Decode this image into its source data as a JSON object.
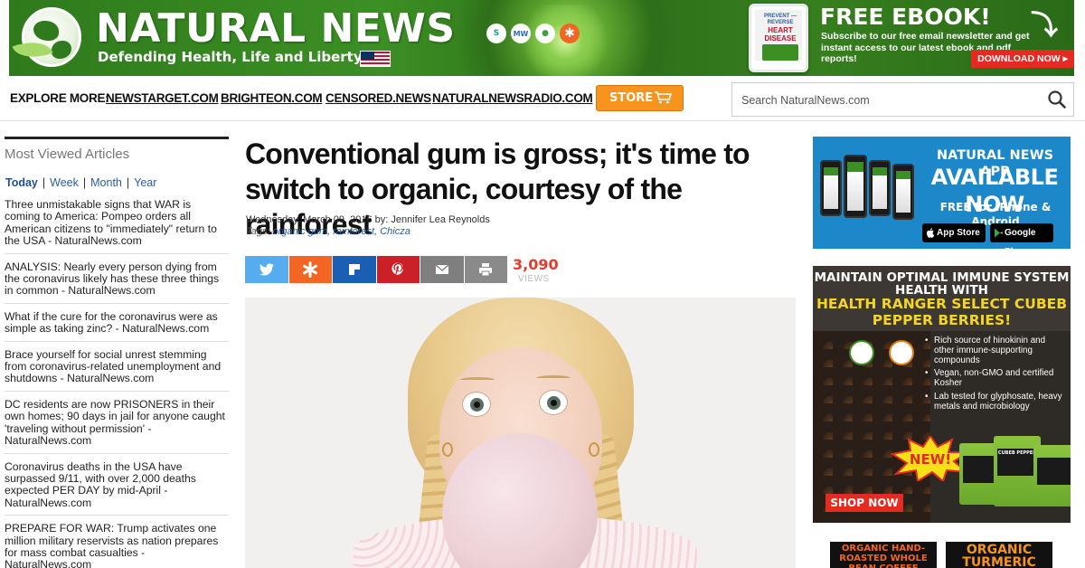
{
  "banner": {
    "site_title": "NATURAL NEWS",
    "tagline": "Defending Health, Life and Liberty",
    "social": [
      "S",
      "MW",
      "●",
      "✱"
    ],
    "ebook_cover_line1": "PREVENT — REVERSE",
    "ebook_cover_line2": "HEART DISEASE",
    "ebook_title": "FREE EBOOK!",
    "ebook_text": "Subscribe to our free email newsletter and get instant access to our latest ebook and pdf reports!",
    "download_label": "DOWNLOAD NOW ▸"
  },
  "nav": {
    "explore_label": "EXPLORE MORE:",
    "links": [
      "NEWSTARGET.COM",
      "BRIGHTEON.COM",
      "CENSORED.NEWS",
      "NATURALNEWSRADIO.COM"
    ],
    "store_label": "STORE",
    "search_placeholder": "Search NaturalNews.com"
  },
  "sidebar": {
    "title": "Most Viewed Articles",
    "tabs": [
      "Today",
      "Week",
      "Month",
      "Year"
    ],
    "active_tab": "Today",
    "articles": [
      "Three unmistakable signs that WAR is coming to America: Pompeo orders all American citizens to \"immediately\" return to the USA - NaturalNews.com",
      "ANALYSIS: Nearly every person dying from the coronavirus likely has these three things in common - NaturalNews.com",
      "What if the cure for the coronavirus were as simple as taking zinc? - NaturalNews.com",
      "Brace yourself for social unrest stemming from coronavirus-related unemployment and shutdowns - NaturalNews.com",
      "DC residents are now PRISONERS in their own homes; 90 days in jail for anyone caught 'traveling without permission' - NaturalNews.com",
      "Coronavirus deaths in the USA have surpassed 9/11, with over 2,000 deaths expected PER DAY by mid-April - NaturalNews.com",
      "PREPARE FOR WAR: Trump activates one million military reservists as nation prepares for mass combat casualties - NaturalNews.com"
    ]
  },
  "article": {
    "headline": "Conventional gum is gross; it's time to switch to organic, courtesy of the rainforest",
    "byline": "Wednesday, March 09, 2016 by: Jennifer Lea Reynolds",
    "tags_label": "Tags:",
    "tags": [
      "organic gum",
      "rainforest",
      "Chicza"
    ],
    "views_count": "3,090",
    "views_label": "VIEWS"
  },
  "ads": {
    "app_line1": "NATURAL NEWS APP",
    "app_line2": "AVAILABLE NOW",
    "app_line3": "FREE for iPhone & Android",
    "app_store": "App Store",
    "google_play": "Google Play",
    "cubeb_line1": "MAINTAIN OPTIMAL IMMUNE SYSTEM HEALTH WITH",
    "cubeb_line2": "HEALTH RANGER SELECT CUBEB PEPPER BERRIES!",
    "cubeb_bullets": [
      "Rich source of hinokinin and other immune-supporting compounds",
      "Vegan, non-GMO and certified Kosher",
      "Lab tested for glyphosate, heavy metals and microbiology"
    ],
    "new_badge": "NEW!",
    "pouch_label": "CUBEB PEPPER",
    "shop_label": "SHOP NOW",
    "bottom_ad1": "ORGANIC HAND-ROASTED WHOLE BEAN COFFEE",
    "bottom_ad2": "ORGANIC TURMERIC"
  },
  "colors": {
    "banner_green": "#3b8f24",
    "store_orange": "#f7941d",
    "views_red": "#e53a2d",
    "link_blue": "#2a5da8",
    "app_blue": "#1c87c9",
    "download_red": "#e32b22"
  }
}
